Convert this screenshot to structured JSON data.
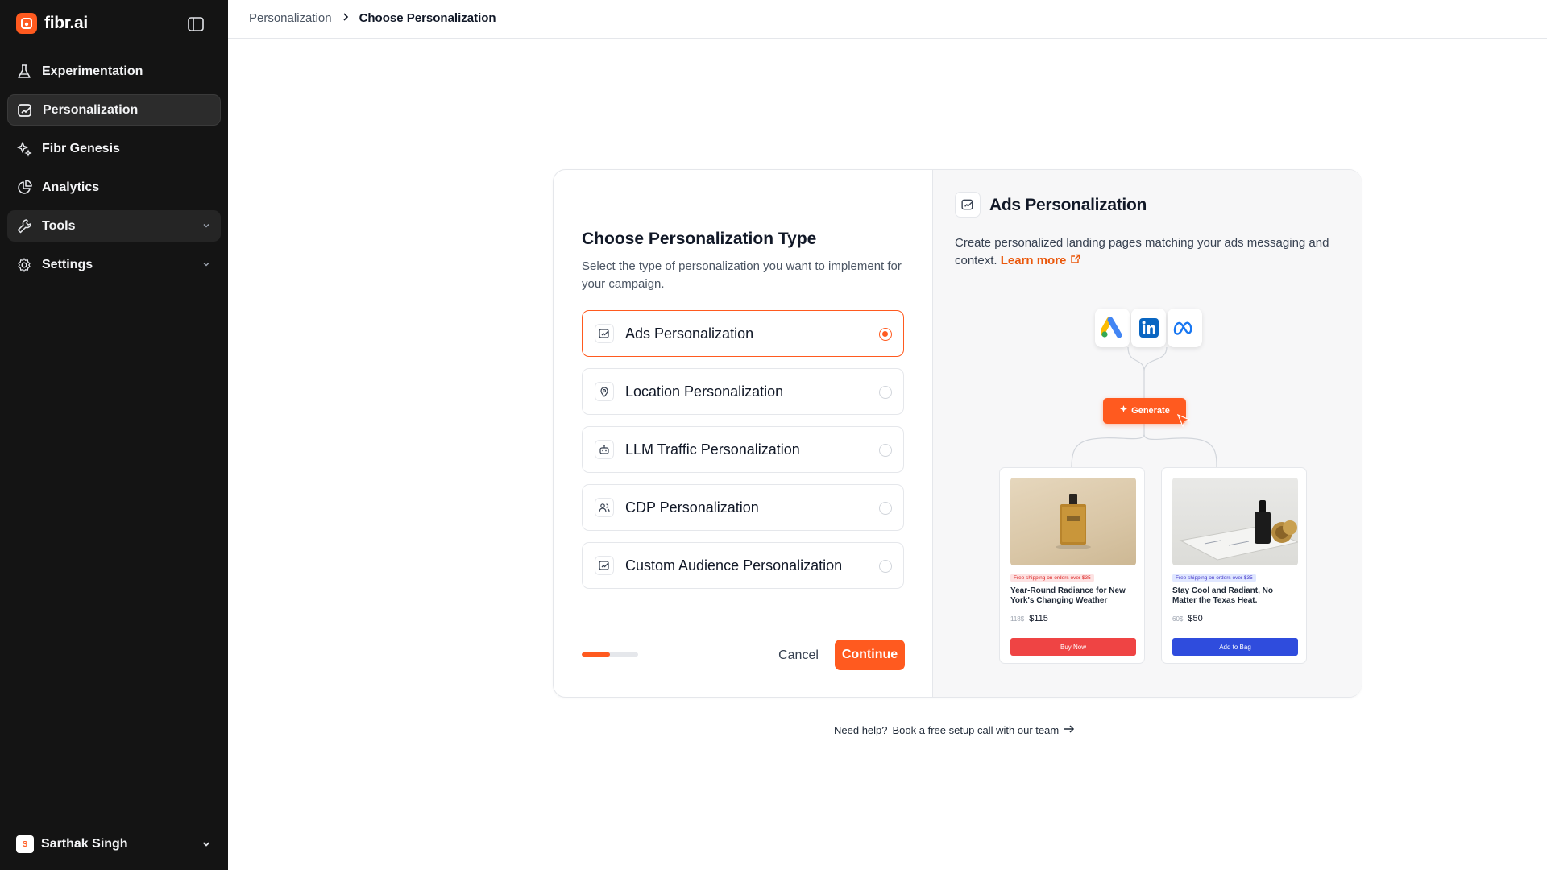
{
  "app": {
    "brand": "fibr.ai",
    "brand_logo_letter": ""
  },
  "sidebar": {
    "items": [
      {
        "label": "Experimentation",
        "icon": "flask-icon"
      },
      {
        "label": "Personalization",
        "icon": "personalization-icon",
        "active": true
      },
      {
        "label": "Fibr Genesis",
        "icon": "sparkles-icon"
      },
      {
        "label": "Analytics",
        "icon": "pie-chart-icon"
      },
      {
        "label": "Tools",
        "icon": "wrench-icon",
        "has_chevron": true
      },
      {
        "label": "Settings",
        "icon": "gear-icon",
        "has_chevron": true
      }
    ],
    "user": {
      "name": "Sarthak Singh",
      "initial": "S"
    }
  },
  "breadcrumb": {
    "parent": "Personalization",
    "current": "Choose Personalization"
  },
  "chooser": {
    "title": "Choose Personalization Type",
    "subtitle": "Select the type of personalization you want to implement for your campaign.",
    "options": [
      {
        "label": "Ads Personalization",
        "icon": "ads-icon",
        "selected": true
      },
      {
        "label": "Location Personalization",
        "icon": "location-pin-icon",
        "selected": false
      },
      {
        "label": "LLM Traffic Personalization",
        "icon": "robot-icon",
        "selected": false
      },
      {
        "label": "CDP Personalization",
        "icon": "users-icon",
        "selected": false
      },
      {
        "label": "Custom Audience Personalization",
        "icon": "custom-audience-icon",
        "selected": false
      }
    ],
    "progress": 0.5,
    "cancel_label": "Cancel",
    "continue_label": "Continue"
  },
  "preview": {
    "title": "Ads Personalization",
    "description": "Create personalized landing pages matching your ads messaging and context.",
    "learn_more": "Learn more",
    "platforms": [
      "google-ads-icon",
      "linkedin-icon",
      "meta-icon"
    ],
    "generate_label": "Generate",
    "cards": [
      {
        "badge": "Free shipping on orders over $35",
        "title": "Year-Round Radiance for New York's Changing Weather",
        "old_price": "118$",
        "price": "$115",
        "button": "Buy Now",
        "accent": "#ef4444",
        "badge_color": "#fde2e2",
        "badge_text": "#dc2626"
      },
      {
        "badge": "Free shipping on orders over $35",
        "title": "Stay Cool and Radiant, No Matter the Texas Heat.",
        "old_price": "60$",
        "price": "$50",
        "button": "Add to Bag",
        "accent": "#2f4cdd",
        "badge_color": "#e0e7ff",
        "badge_text": "#4338ca"
      }
    ]
  },
  "help": {
    "prefix": "Need help?",
    "link": "Book a free setup call with our team"
  },
  "colors": {
    "accent": "#ff5a1f",
    "sidebar_bg": "#141414"
  }
}
